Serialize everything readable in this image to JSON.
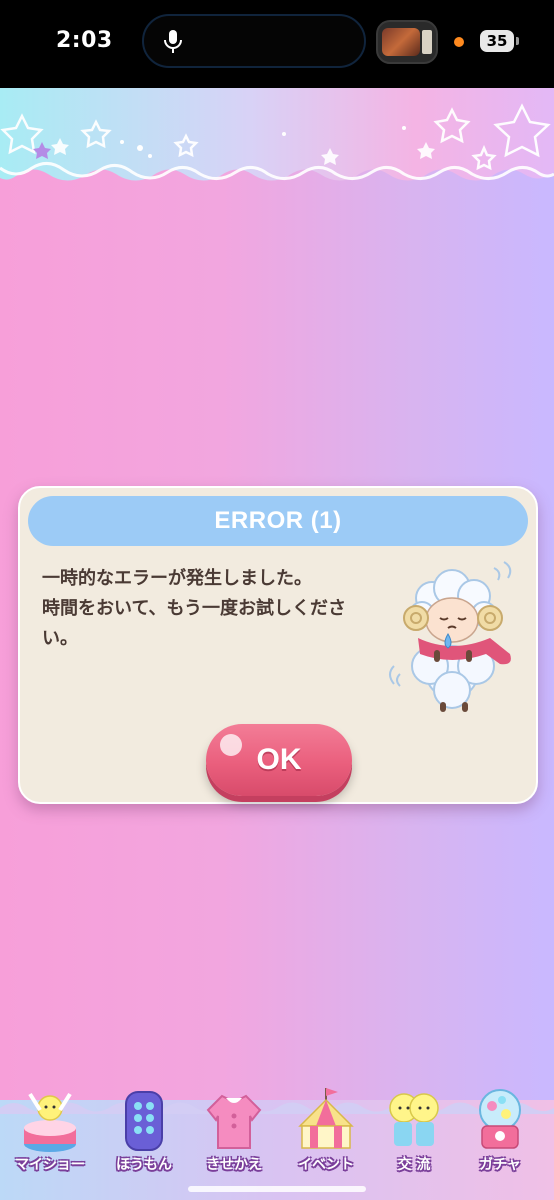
{
  "status_bar": {
    "time": "2:03",
    "battery": "35",
    "mic_icon": "microphone-icon",
    "privacy_dot_color": "#ff8a1f"
  },
  "dialog": {
    "title": "ERROR (1)",
    "message": "一時的なエラーが発生しました。\n時間をおいて、もう一度お試しくださ\nい。",
    "ok_label": "OK",
    "mascot_icon": "sheep-mascot-icon",
    "header_color": "#9ccbf6",
    "button_color": "#ea5f7d"
  },
  "bottom_nav": {
    "items": [
      {
        "label": "マイショー",
        "icon": "stage-icon"
      },
      {
        "label": "ほうもん",
        "icon": "door-icon"
      },
      {
        "label": "きせかえ",
        "icon": "dress-icon"
      },
      {
        "label": "イベント",
        "icon": "tent-icon"
      },
      {
        "label": "交 流",
        "icon": "friends-icon"
      },
      {
        "label": "ガチャ",
        "icon": "gacha-icon"
      }
    ]
  }
}
